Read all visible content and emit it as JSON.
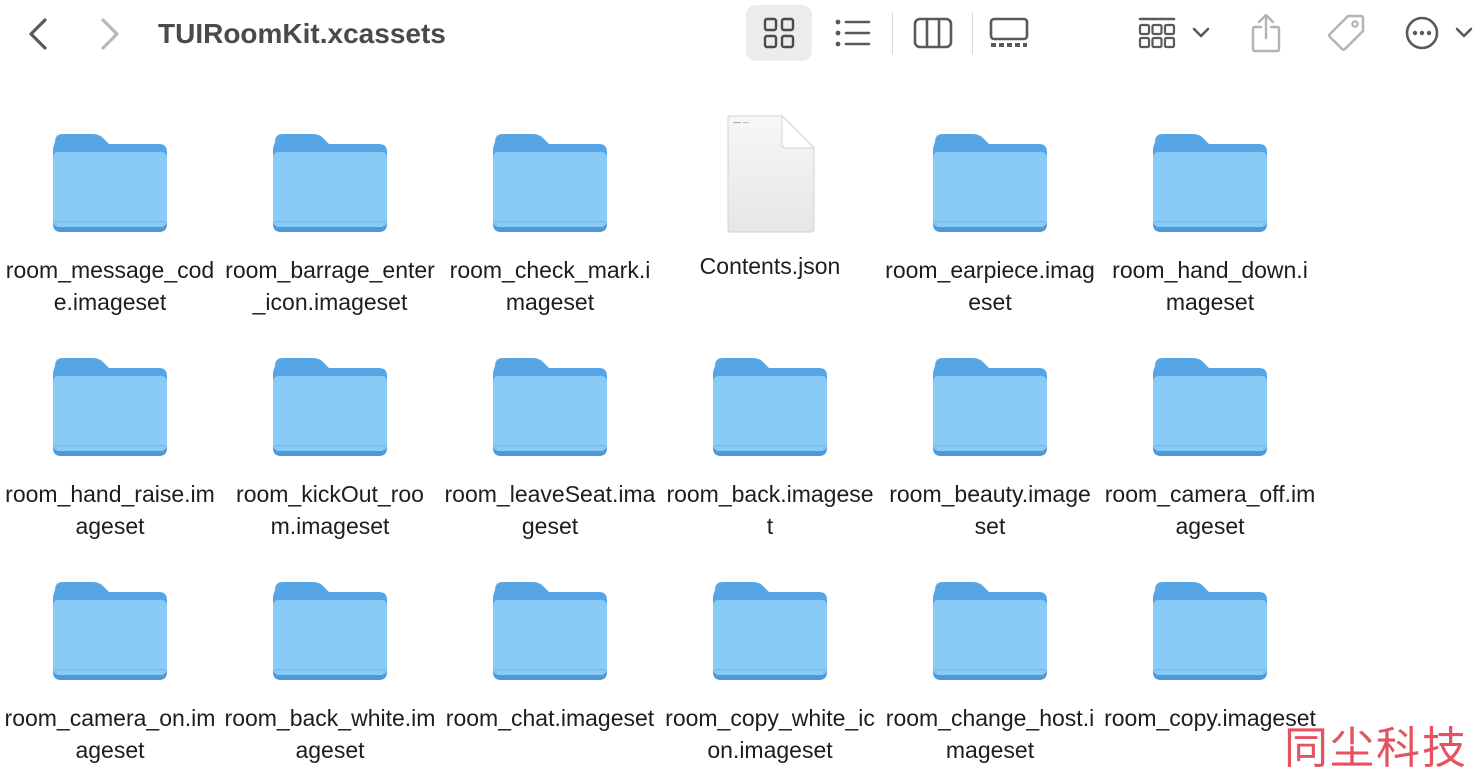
{
  "window": {
    "title": "TUIRoomKit.xcassets"
  },
  "toolbar": {
    "back_icon": "chevron-left-icon",
    "forward_icon": "chevron-right-icon",
    "views": [
      {
        "name": "icon-view",
        "icon": "grid-icon",
        "selected": true
      },
      {
        "name": "list-view",
        "icon": "list-icon",
        "selected": false
      },
      {
        "name": "column-view",
        "icon": "columns-icon",
        "selected": false
      },
      {
        "name": "gallery-view",
        "icon": "gallery-icon",
        "selected": false
      }
    ],
    "group_icon": "group-by-icon",
    "share_icon": "share-icon",
    "tag_icon": "tag-icon",
    "more_icon": "more-ellipsis-icon",
    "selected_bg": "#ececec"
  },
  "colors": {
    "folder_body": "#89cbf7",
    "folder_tab": "#56a6e6",
    "folder_shadow": "#4f98d9",
    "watermark": "#e0424f"
  },
  "items": [
    {
      "type": "folder",
      "label": "room_message_code.imageset"
    },
    {
      "type": "folder",
      "label": "room_barrage_enter_icon.imageset"
    },
    {
      "type": "folder",
      "label": "room_check_mark.imageset"
    },
    {
      "type": "document",
      "label": "Contents.json"
    },
    {
      "type": "folder",
      "label": "room_earpiece.imageset"
    },
    {
      "type": "folder",
      "label": "room_hand_down.imageset"
    },
    {
      "type": "folder",
      "label": "room_hand_raise.imageset"
    },
    {
      "type": "folder",
      "label": "room_kickOut_room.imageset"
    },
    {
      "type": "folder",
      "label": "room_leaveSeat.imageset"
    },
    {
      "type": "folder",
      "label": "room_back.imageset"
    },
    {
      "type": "folder",
      "label": "room_beauty.imageset"
    },
    {
      "type": "folder",
      "label": "room_camera_off.imageset"
    },
    {
      "type": "folder",
      "label": "room_camera_on.imageset"
    },
    {
      "type": "folder",
      "label": "room_back_white.imageset"
    },
    {
      "type": "folder",
      "label": "room_chat.imageset"
    },
    {
      "type": "folder",
      "label": "room_copy_white_icon.imageset"
    },
    {
      "type": "folder",
      "label": "room_change_host.imageset"
    },
    {
      "type": "folder",
      "label": "room_copy.imageset"
    }
  ],
  "watermark": {
    "text": "同尘科技"
  }
}
